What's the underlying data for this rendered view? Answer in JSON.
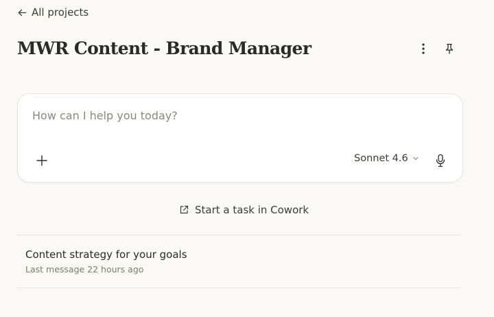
{
  "nav": {
    "back_label": "All projects"
  },
  "project": {
    "title": "MWR Content - Brand Manager"
  },
  "composer": {
    "placeholder": "How can I help you today?",
    "model": "Sonnet 4.6"
  },
  "cowork": {
    "label": "Start a task in Cowork"
  },
  "chats": [
    {
      "title": "Content strategy for your goals",
      "meta": "Last message 22 hours ago"
    }
  ],
  "icons": {
    "back": "arrow-left-icon",
    "more": "more-vertical-icon",
    "pin": "pin-icon",
    "add": "plus-icon",
    "model_dropdown": "chevron-down-icon",
    "mic": "microphone-icon",
    "cowork": "external-link-icon"
  }
}
